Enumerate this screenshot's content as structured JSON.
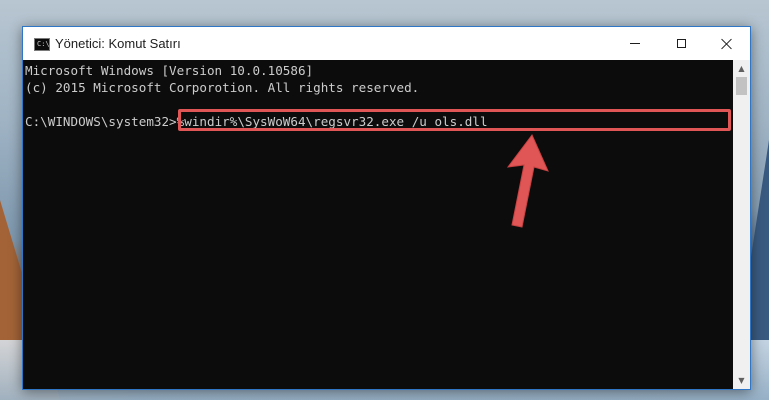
{
  "window": {
    "title": "Yönetici: Komut Satırı",
    "controls": {
      "minimize_icon": "minimize-icon",
      "maximize_icon": "maximize-icon",
      "close_icon": "close-icon"
    }
  },
  "console": {
    "lines": [
      "Microsoft Windows [Version 10.0.10586]",
      "(c) 2015 Microsoft Corporotion. All rights reserved."
    ],
    "prompt": "C:\\WINDOWS\\system32>",
    "command": "%windir%\\SysWoW64\\regsvr32.exe /u ols.dll"
  },
  "colors": {
    "console_bg": "#0c0c0c",
    "console_text": "#cccccc",
    "highlight": "#e05555",
    "arrow": "#e05555"
  }
}
